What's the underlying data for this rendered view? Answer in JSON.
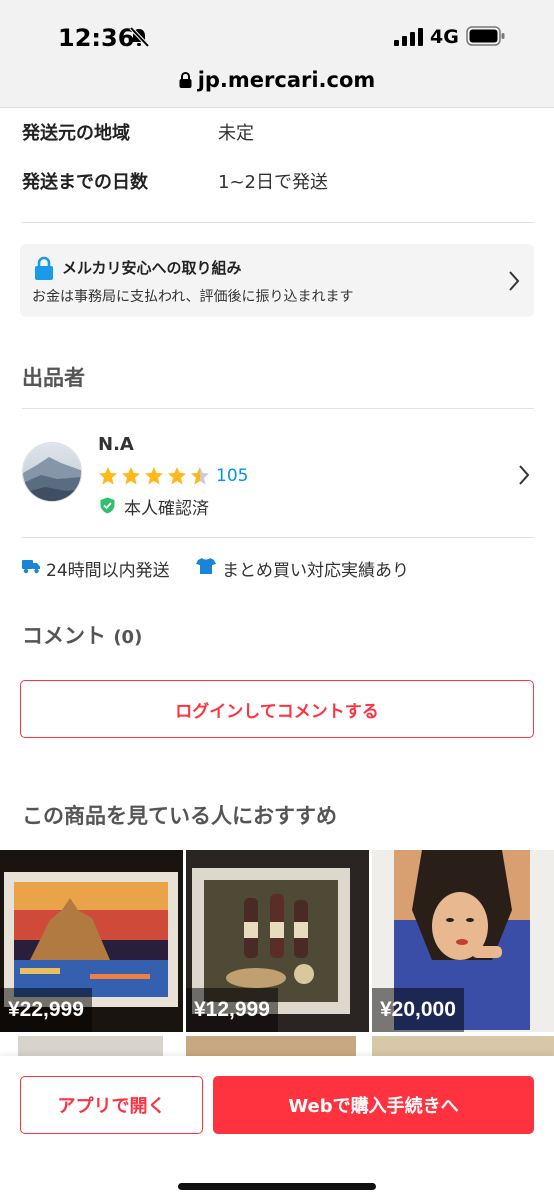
{
  "status_bar": {
    "time": "12:36",
    "network": "4G"
  },
  "browser": {
    "url": "jp.mercari.com"
  },
  "shipping": [
    {
      "label": "発送元の地域",
      "value": "未定"
    },
    {
      "label": "発送までの日数",
      "value": "1~2日で発送"
    }
  ],
  "safety": {
    "title": "メルカリ安心への取り組み",
    "description": "お金は事務局に支払われ、評価後に振り込まれます"
  },
  "seller_section": {
    "title": "出品者",
    "name": "N.A",
    "rating_stars": 4.5,
    "rating_count": "105",
    "verified_label": "本人確認済"
  },
  "badges": [
    {
      "icon": "truck-icon",
      "label": "24時間以内発送"
    },
    {
      "icon": "tshirt-icon",
      "label": "まとめ買い対応実績あり"
    }
  ],
  "comments": {
    "title": "コメント",
    "count": "(0)",
    "login_button": "ログインしてコメントする"
  },
  "recommendations": {
    "title": "この商品を見ている人におすすめ",
    "items": [
      {
        "price": "¥22,999"
      },
      {
        "price": "¥12,999"
      },
      {
        "price": "¥20,000"
      }
    ]
  },
  "actions": {
    "open_app": "アプリで開く",
    "purchase": "Webで購入手続きへ"
  },
  "colors": {
    "accent": "#ff333f",
    "link": "#0095ee",
    "star": "#ffb818",
    "verified": "#33c06e",
    "icon_blue": "#1a85d6"
  }
}
